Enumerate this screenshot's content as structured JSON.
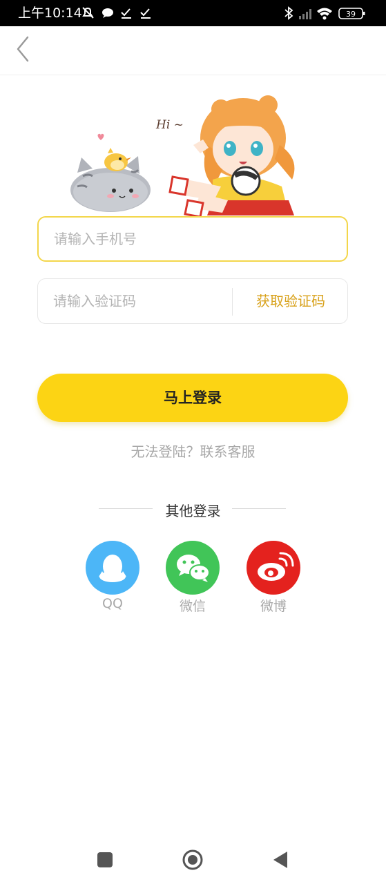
{
  "status_bar": {
    "time": "上午10:14",
    "battery": "39",
    "icons": [
      "mute-icon",
      "chat-icon",
      "check-icon",
      "check-icon",
      "bluetooth-icon",
      "signal-icon",
      "wifi-icon",
      "battery-icon"
    ]
  },
  "header": {
    "back_icon": "chevron-left-icon"
  },
  "illustration": {
    "greeting": "Hi ~"
  },
  "form": {
    "phone_placeholder": "请输入手机号",
    "code_placeholder": "请输入验证码",
    "get_code_label": "获取验证码",
    "login_label": "马上登录",
    "help_link": "无法登陆？联系客服"
  },
  "other_login": {
    "title": "其他登录",
    "options": [
      {
        "label": "QQ",
        "icon": "qq-icon",
        "color": "#4cb6f7"
      },
      {
        "label": "微信",
        "icon": "wechat-icon",
        "color": "#41c558"
      },
      {
        "label": "微博",
        "icon": "weibo-icon",
        "color": "#e4221e"
      }
    ]
  },
  "colors": {
    "accent": "#fcd414",
    "get_code": "#d8a11a",
    "phone_border": "#f3d64a"
  },
  "nav_bar": {
    "icons": [
      "recent-apps-icon",
      "home-icon",
      "back-triangle-icon"
    ]
  }
}
